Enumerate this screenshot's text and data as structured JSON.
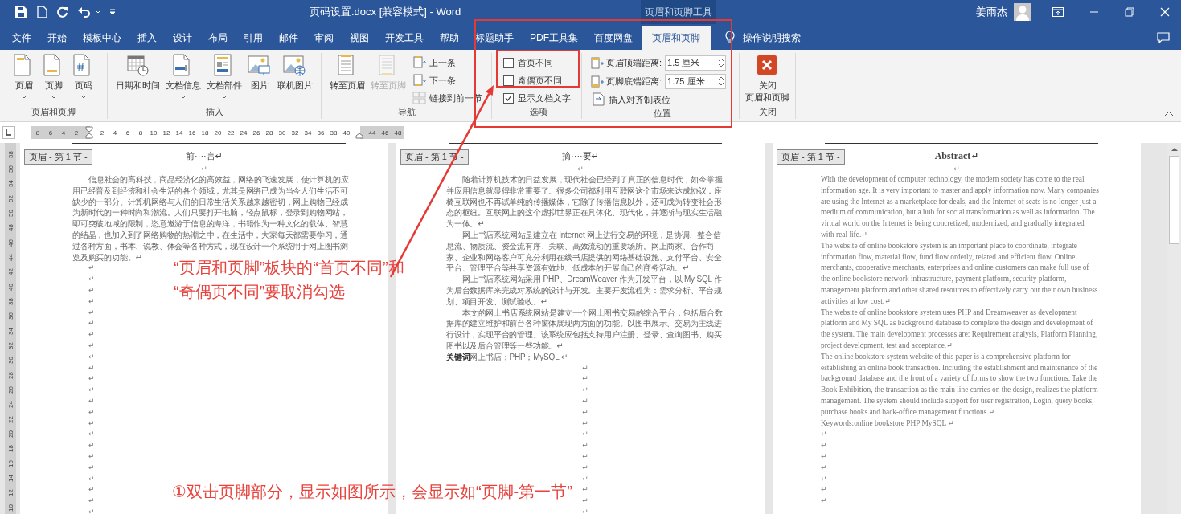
{
  "title_bar": {
    "title": "页码设置.docx [兼容模式] - Word",
    "contextual_label": "页眉和页脚工具",
    "user_name": "姜雨杰"
  },
  "tabs": [
    {
      "label": "文件",
      "selected": false
    },
    {
      "label": "开始",
      "selected": false
    },
    {
      "label": "模板中心",
      "selected": false
    },
    {
      "label": "插入",
      "selected": false
    },
    {
      "label": "设计",
      "selected": false
    },
    {
      "label": "布局",
      "selected": false
    },
    {
      "label": "引用",
      "selected": false
    },
    {
      "label": "邮件",
      "selected": false
    },
    {
      "label": "审阅",
      "selected": false
    },
    {
      "label": "视图",
      "selected": false
    },
    {
      "label": "开发工具",
      "selected": false
    },
    {
      "label": "帮助",
      "selected": false
    },
    {
      "label": "标题助手",
      "selected": false
    },
    {
      "label": "PDF工具集",
      "selected": false
    },
    {
      "label": "百度网盘",
      "selected": false
    },
    {
      "label": "页眉和页脚",
      "selected": true
    }
  ],
  "tell_me": "操作说明搜索",
  "ribbon": {
    "groups": [
      {
        "label": "页眉和页脚",
        "items": [
          {
            "kind": "large",
            "label": "页眉",
            "dropdown": true,
            "disabled": false
          },
          {
            "kind": "large",
            "label": "页脚",
            "dropdown": true,
            "disabled": false
          },
          {
            "kind": "large",
            "label": "页码",
            "dropdown": true,
            "disabled": false
          }
        ]
      },
      {
        "label": "插入",
        "items": [
          {
            "kind": "large",
            "label": "日期和时间",
            "dropdown": false,
            "disabled": false
          },
          {
            "kind": "large",
            "label": "文档信息",
            "dropdown": true,
            "disabled": false
          },
          {
            "kind": "large",
            "label": "文档部件",
            "dropdown": true,
            "disabled": false
          },
          {
            "kind": "large",
            "label": "图片",
            "dropdown": false,
            "disabled": false
          },
          {
            "kind": "large",
            "label": "联机图片",
            "dropdown": false,
            "disabled": false
          }
        ]
      },
      {
        "label": "导航",
        "items": [
          {
            "kind": "large",
            "label": "转至页眉",
            "dropdown": false,
            "disabled": false
          },
          {
            "kind": "large",
            "label": "转至页脚",
            "dropdown": false,
            "disabled": true
          },
          {
            "kind": "small",
            "label": "上一条",
            "disabled": false
          },
          {
            "kind": "small",
            "label": "下一条",
            "disabled": false
          },
          {
            "kind": "small",
            "label": "链接到前一节",
            "disabled": true
          }
        ]
      },
      {
        "label": "选项",
        "items": [
          {
            "kind": "checkbox",
            "label": "首页不同",
            "checked": false
          },
          {
            "kind": "checkbox",
            "label": "奇偶页不同",
            "checked": false
          },
          {
            "kind": "checkbox",
            "label": "显示文档文字",
            "checked": true
          }
        ]
      },
      {
        "label": "位置",
        "items": [
          {
            "kind": "spinner",
            "label": "页眉顶端距离:",
            "value": "1.5 厘米"
          },
          {
            "kind": "spinner",
            "label": "页脚底端距离:",
            "value": "1.75 厘米"
          },
          {
            "kind": "small",
            "label": "插入对齐制表位",
            "disabled": false
          }
        ]
      },
      {
        "label": "关闭",
        "items": [
          {
            "kind": "large",
            "lines": [
              "关闭",
              "页眉和页脚"
            ],
            "dropdown": false,
            "disabled": false
          }
        ]
      }
    ]
  },
  "ruler": {
    "left_numbers": [
      "8",
      "6",
      "4",
      "2"
    ],
    "numbers": [
      "2",
      "4",
      "6",
      "8",
      "10",
      "12",
      "14",
      "16",
      "18",
      "20",
      "22",
      "24",
      "26",
      "28",
      "30",
      "32",
      "34",
      "36",
      "38",
      "40"
    ],
    "right_numbers": [
      "44",
      "46",
      "48"
    ]
  },
  "vertical_ruler": {
    "numbers": [
      "58",
      "56",
      "54",
      "52",
      "50",
      "48",
      "46",
      "44",
      "42",
      "40",
      "38",
      "36",
      "34",
      "32",
      "30",
      "28",
      "26",
      "24",
      "22",
      "20",
      "18",
      "16",
      "14",
      "12",
      "10"
    ]
  },
  "pages": [
    {
      "kind": "cjk",
      "header_tag": "页眉 - 第 1 节 -",
      "heading": "前····言↵",
      "after_heading": "↵",
      "paragraphs": [
        {
          "text": "信息社会的高科技，商品经济化的高效益，网络的飞速发展，使计算机的应用已经普及到经济和社会生活的各个领域，尤其是网络已成为当今人们生活不可缺少的一部分。计算机网络与人们的日常生活关系越来越密切，网上购物已经成为新时代的一种时尚和潮流。人们只要打开电脑，轻点鼠标，登录到购物网站，即可突破地域的限制，恣意遨游于信息的海洋，书籍作为一种文化的载体、智慧的结晶，也加入到了网络购物的热潮之中，在生活中，大家每天都需要学习，通过各种方面，书本、说教、体会等各种方式，现在设计一个系统用于网上图书浏览及购买的功能。↵",
          "indent": true
        }
      ],
      "blank_marks": [
        "↵",
        "↵",
        "↵",
        "↵",
        "↵",
        "↵",
        "↵",
        "↵",
        "↵",
        "↵",
        "↵",
        "↵",
        "↵",
        "↵",
        "↵",
        "↵",
        "↵",
        "↵",
        "↵",
        "↵",
        "↵",
        "↵",
        "↵"
      ]
    },
    {
      "kind": "cjk",
      "header_tag": "页眉 - 第 1 节 -",
      "heading": "摘····要↵",
      "after_heading": "↵",
      "paragraphs": [
        {
          "text": "随着计算机技术的日益发展，现代社会已经到了真正的信息时代，如今掌握并应用信息就显得非常重要了。很多公司都利用互联网这个市场来达成协议，座椅互联网也不再试单纯的传播媒体，它除了传播信息以外，还可成为转变社会形态的枢纽。互联网上的这个虚拟世界正在具体化、现代化，并逐渐与现实生活融为一体。↵",
          "indent": true
        },
        {
          "text": "网上书店系统网站是建立在 Internet 网上进行交易的环境，是协调、整合信息流、物质流、资金流有序、关联、高效流动的重要场所。网上商家、合作商家、企业和网络客户可充分利用在线书店提供的网络基础设施、支付平台、安全平台、管理平台等共享资源有效地、低成本的开展自己的商务活动。↵",
          "indent": true
        },
        {
          "text": "网上书店系统网站采用 PHP、DreamWeaver 作为开发平台，以 My SQL 作为后台数据库来完成对系统的设计与开发。主要开发流程为：需求分析、平台规划、项目开发、测试验收。↵",
          "indent": true
        },
        {
          "text": "本文的网上书店系统网站是建立一个网上图书交易的综合平台，包括后台数据库的建立维护和前台各种窗体展现两方面的功能。以图书展示、交易为主线进行设计，实现平台的管理。该系统应包括支持用户注册、登录、查询图书、购买图书以及后台管理等一些功能。↵",
          "indent": true
        },
        {
          "text": "**关键词**网上书店；PHP；MySQL ↵",
          "indent": false
        }
      ],
      "blank_marks": [
        "↵",
        "↵",
        "↵",
        "↵",
        "↵",
        "↵",
        "↵",
        "↵",
        "↵",
        "↵",
        "↵",
        "↵",
        "↵",
        "↵"
      ]
    },
    {
      "kind": "latin",
      "header_tag": "页眉 - 第 1 节 -",
      "heading": "Abstract↵",
      "after_heading": "↵",
      "paragraphs": [
        {
          "text": "With the development of computer technology, the modern society has come to the real information age. It is very important to master and apply information now. Many companies are using the Internet as a marketplace for deals, and the Internet of seats is no longer just a medium of communication, but a hub for social transformation as well as information. The virtual world on the Internet is being concretized, modernized, and gradually integrated with real life.↵",
          "indent": false
        },
        {
          "text": "The website of online bookstore system is an important place to coordinate, integrate information flow, material flow, fund flow orderly, related and efficient flow. Online merchants, cooperative merchants, enterprises and online customers can make full use of the online bookstore network infrastructure, payment platform, security platform, management platform and other shared resources to effectively carry out their own business activities at low cost.↵",
          "indent": false
        },
        {
          "text": "The website of online bookstore system uses PHP and Dreamweaver as development platform and My SQL as background database to complete the design and development of the system. The main development processes are: Requirement analysis, Platform Planning, project development, test and acceptance.↵",
          "indent": false
        },
        {
          "text": "The online bookstore system website of this paper is a comprehensive platform for establishing an online book transaction. Including the establishment and maintenance of the background database and the front of a variety of forms to show the two functions. Take the Book Exhibition, the transaction as the main line carries on the design, realizes the platform management. The system should include support for user registration, Login, query books, purchase books and back-office management functions.↵",
          "indent": false
        },
        {
          "text": "Keywords:online bookstore PHP MySQL ↵",
          "indent": false
        }
      ],
      "blank_marks": [
        "↵",
        "↵",
        "↵",
        "↵",
        "↵",
        "↵",
        "↵"
      ]
    }
  ],
  "annotations": [
    {
      "kind": "callout",
      "lines": [
        "“页眉和页脚”板块的“首页不同”和",
        "“奇偶页不同”要取消勾选"
      ]
    },
    {
      "kind": "step",
      "lines": [
        "①双击页脚部分，显示如图所示，会显示如“页脚-第一节”"
      ]
    }
  ]
}
